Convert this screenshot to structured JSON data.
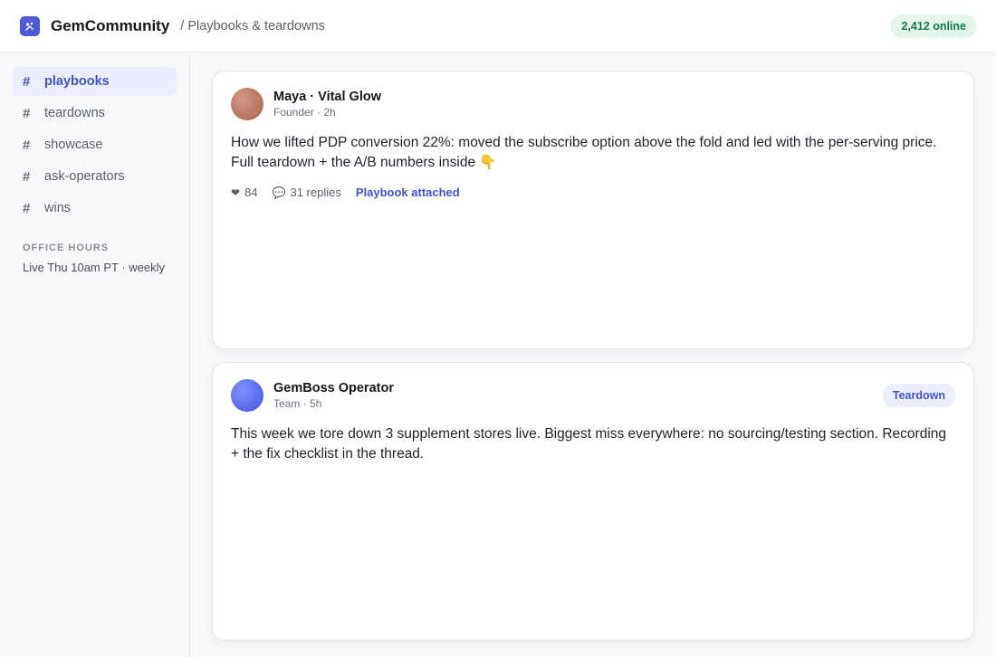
{
  "header": {
    "brand": "GemCommunity",
    "breadcrumb": "/ Playbooks & teardowns",
    "online_badge": "2,412 online"
  },
  "sidebar": {
    "channels": [
      {
        "label": "playbooks",
        "active": true
      },
      {
        "label": "teardowns",
        "active": false
      },
      {
        "label": "showcase",
        "active": false
      },
      {
        "label": "ask-operators",
        "active": false
      },
      {
        "label": "wins",
        "active": false
      }
    ],
    "hash": "#",
    "office_hours_title": "OFFICE HOURS",
    "office_hours_text": "Live Thu 10am PT · weekly"
  },
  "posts": [
    {
      "author": "Maya · Vital Glow",
      "meta": "Founder · 2h",
      "body": "How we lifted PDP conversion 22%: moved the subscribe option above the fold and led with the per-serving price. Full teardown + the A/B numbers inside 👇",
      "likes": "84",
      "replies": "31 replies",
      "attachment": "Playbook attached"
    },
    {
      "author": "GemBoss Operator",
      "meta": "Team · 5h",
      "tag": "Teardown",
      "body": "This week we tore down 3 supplement stores live. Biggest miss everywhere: no sourcing/testing section. Recording + the fix checklist in the thread."
    }
  ],
  "colors": {
    "accent": "#4f5bd5",
    "online": "#137a48"
  }
}
